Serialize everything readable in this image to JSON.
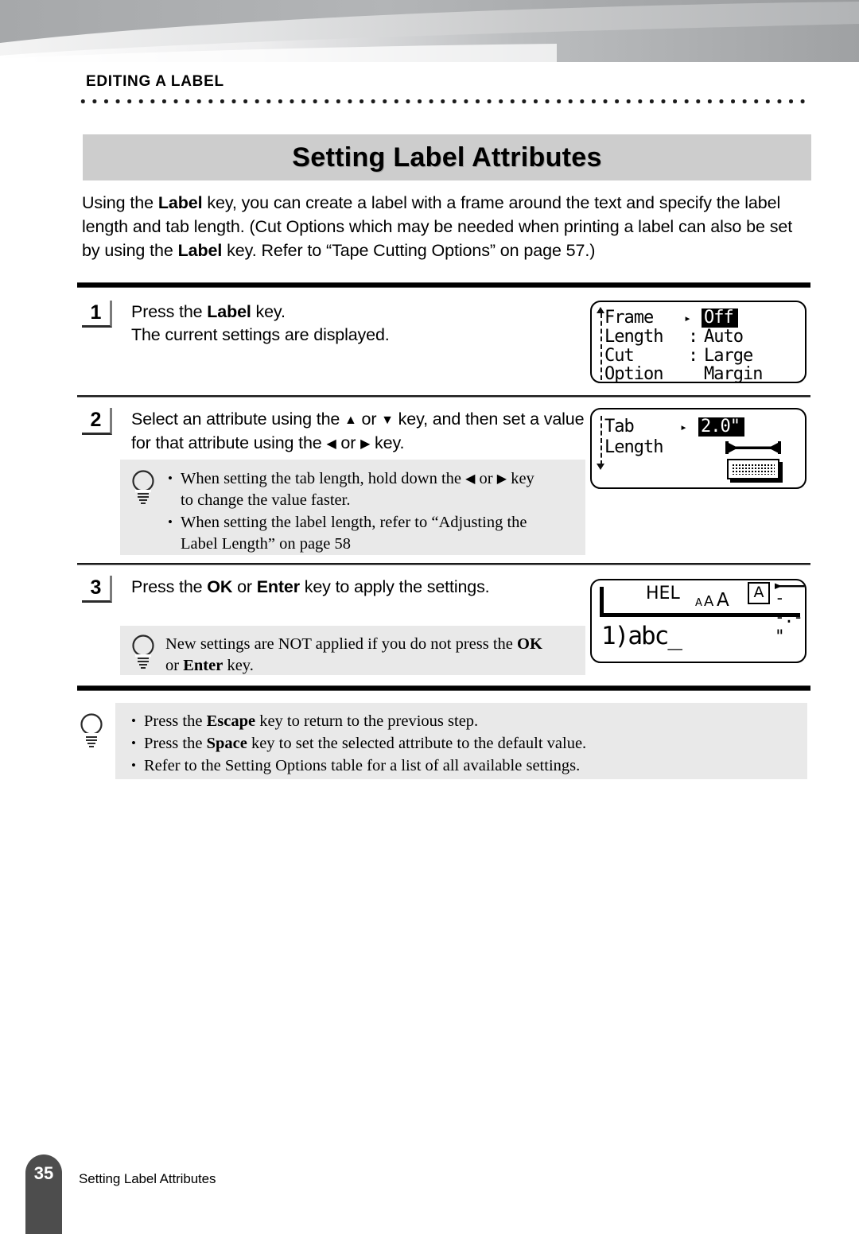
{
  "header": {
    "chapter_label": "EDITING A LABEL",
    "title": "Setting Label Attributes"
  },
  "intro": {
    "part1": "Using the ",
    "bold1": "Label",
    "part2": " key, you can create a label with a frame around the text and specify the label length and tab length. (Cut Options which may be needed when printing a label can also be set by using the ",
    "bold2": "Label",
    "part3": " key. Refer to “Tape Cutting Options”  on page 57.)"
  },
  "steps": [
    {
      "number": "1",
      "line1_pre": "Press the ",
      "line1_bold": "Label",
      "line1_post": " key.",
      "line2": "The current settings are displayed."
    },
    {
      "number": "2",
      "line1_a": "Select an attribute using the ",
      "arrow_up": "▲",
      "line1_b": " or ",
      "arrow_down": "▼",
      "line1_c": " key, and then set a value for that attribute using the ",
      "arrow_left": "◀",
      "line1_d": " or ",
      "arrow_right": "▶",
      "line1_e": " key."
    },
    {
      "number": "3",
      "line1_pre": "Press the ",
      "line1_bold1": "OK",
      "line1_mid": " or ",
      "line1_bold2": "Enter",
      "line1_post": " key to apply the settings."
    }
  ],
  "notes": {
    "step2_note": {
      "bullet1_a": "When setting the tab length, hold down the ",
      "bullet1_arrow_left": "◀",
      "bullet1_b": " or ",
      "bullet1_arrow_right": "▶",
      "bullet1_c": " key",
      "bullet1_line2": "to change the value faster.",
      "bullet2_line1": "When setting the label length, refer to “Adjusting the",
      "bullet2_line2": "Label Length” on page 58"
    },
    "step3_note": {
      "line1_pre": "New settings are NOT applied if you do not press the ",
      "line1_bold": "OK",
      "line2_pre": "or ",
      "line2_bold": "Enter",
      "line2_post": " key."
    },
    "bottom_note": {
      "bullet1_pre": "Press the ",
      "bullet1_bold": "Escape",
      "bullet1_post": " key to return to the previous step.",
      "bullet2_pre": "Press the ",
      "bullet2_bold": "Space",
      "bullet2_post": " key to set the selected attribute to the default value.",
      "bullet3": "Refer to the Setting Options table for a list of all available settings."
    }
  },
  "lcd1": {
    "rows": [
      {
        "key": "Frame",
        "sep": "▸",
        "value": "Off",
        "highlighted": true
      },
      {
        "key": "Length",
        "sep": ":",
        "value": "Auto",
        "highlighted": false
      },
      {
        "key": "Cut",
        "sep": ":",
        "value": "Large",
        "highlighted": false
      },
      {
        "key": "Option",
        "sep": "",
        "value": "Margin",
        "highlighted": false
      }
    ]
  },
  "lcd2": {
    "label_line1": "Tab",
    "label_line2": "Length",
    "sep": "▸",
    "value": "2.0\"",
    "value_highlighted": true
  },
  "lcd3": {
    "font_name": "HEL",
    "size_icon": "size-aaa-icon",
    "frame_icon_letter": "A",
    "length_readout": "--.-\"",
    "text_line": "1)abc_"
  },
  "footer": {
    "page_number": "35",
    "section_name": "Setting Label Attributes"
  },
  "colors": {
    "title_bar_bg": "#cdcdcd",
    "note_bg": "#e9e9e9",
    "footer_tab_bg": "#4d4d4d",
    "rule": "#000000"
  }
}
